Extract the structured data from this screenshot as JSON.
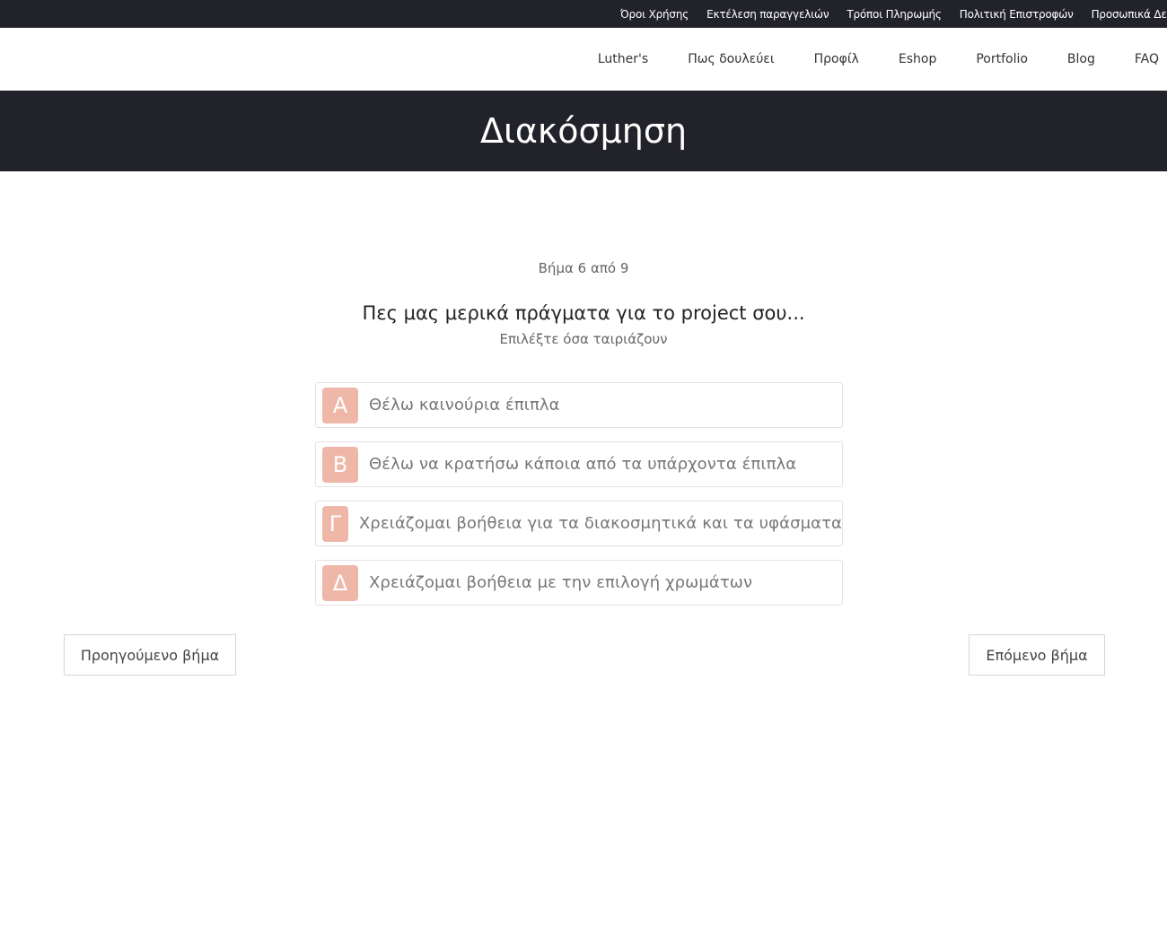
{
  "topbar": {
    "links": [
      "Όροι Χρήσης",
      "Εκτέλεση παραγγελιών",
      "Τρόποι Πληρωμής",
      "Πολιτική Επιστροφών",
      "Προσωπικά Δεδομένα"
    ]
  },
  "nav": {
    "links": [
      "Luther's",
      "Πως δουλεύει",
      "Προφίλ",
      "Eshop",
      "Portfolio",
      "Blog",
      "FAQ"
    ]
  },
  "hero": {
    "title": "Διακόσμηση"
  },
  "form": {
    "step_counter": "Βήμα 6 από 9",
    "question": "Πες μας μερικά πράγματα για το project σου...",
    "hint": "Επιλέξτε όσα ταιριάζουν",
    "options": [
      {
        "key": "Α",
        "label": "Θέλω καινούρια έπιπλα"
      },
      {
        "key": "Β",
        "label": "Θέλω να κρατήσω κάποια από τα υπάρχοντα έπιπλα"
      },
      {
        "key": "Γ",
        "label": "Χρειάζομαι βοήθεια για τα διακοσμητικά και τα υφάσματα"
      },
      {
        "key": "Δ",
        "label": "Χρειάζομαι βοήθεια με την επιλογή χρωμάτων"
      }
    ],
    "prev_button": "Προηγούμενο βήμα",
    "next_button": "Επόμενο βήμα"
  },
  "colors": {
    "dark_bg": "#22232a",
    "accent": "#efb7a8"
  }
}
